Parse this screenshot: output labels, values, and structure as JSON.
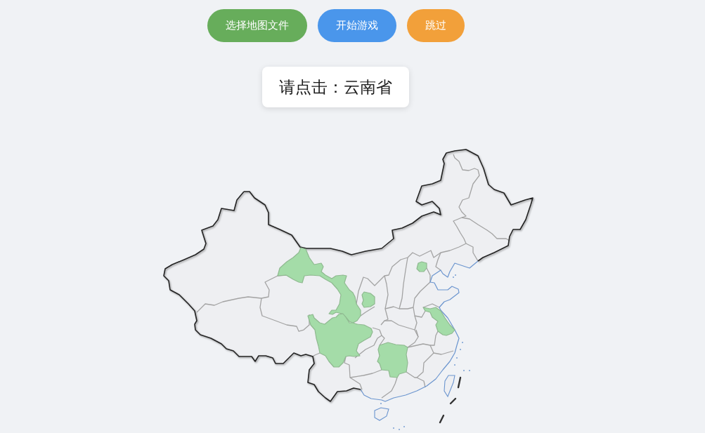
{
  "toolbar": {
    "buttons": [
      {
        "kind": "success",
        "label": "选择地图文件"
      },
      {
        "kind": "primary",
        "label": "开始游戏"
      },
      {
        "kind": "warning",
        "label": "跳过"
      }
    ]
  },
  "prompt": {
    "text": "请点击：云南省"
  },
  "map": {
    "regions": [
      {
        "highlighted": true
      },
      {
        "highlighted": true
      },
      {
        "highlighted": true
      },
      {
        "highlighted": true
      },
      {
        "highlighted": true
      },
      {
        "highlighted": true
      }
    ]
  }
}
